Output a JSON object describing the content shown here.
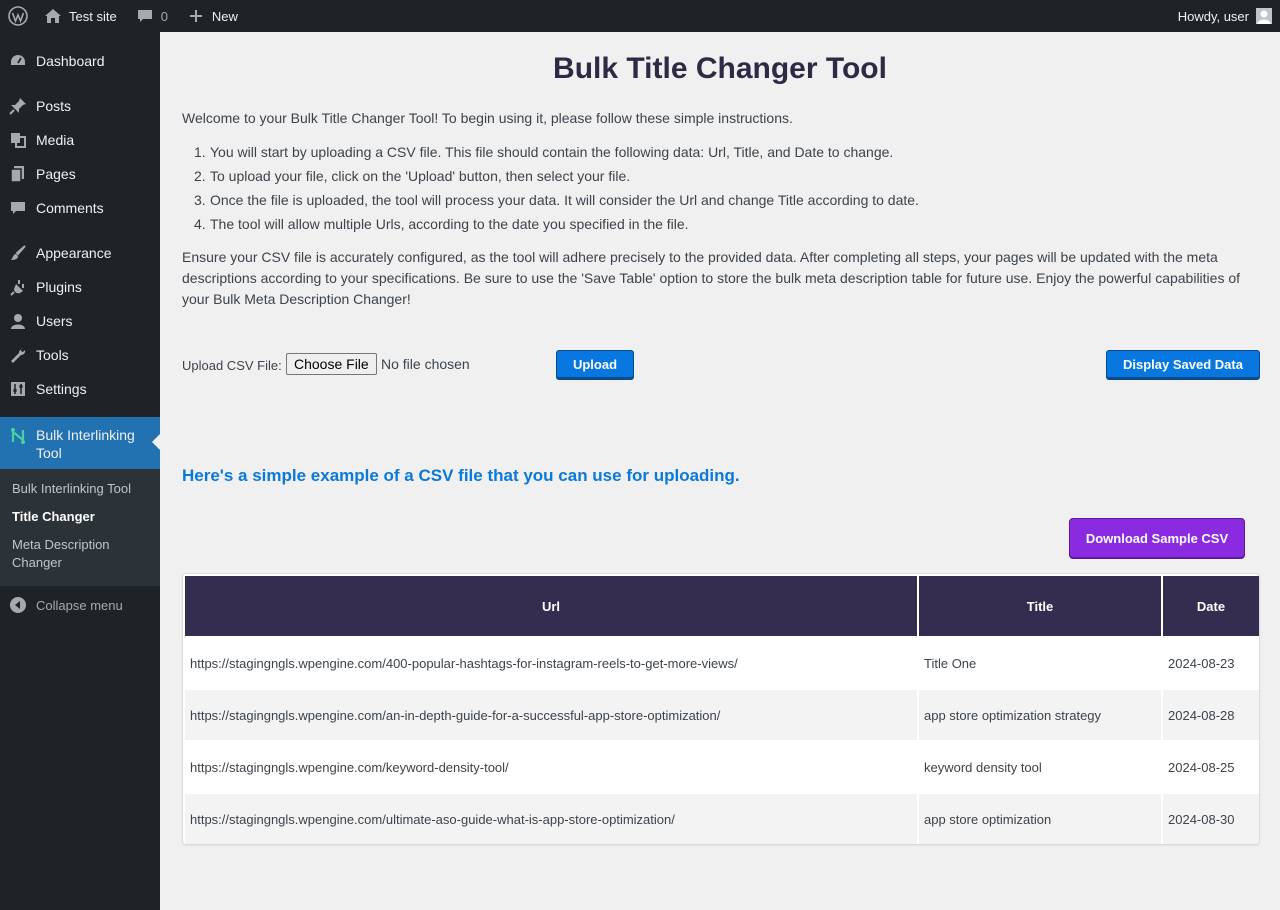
{
  "adminbar": {
    "site_name": "Test site",
    "comments_count": "0",
    "new_label": "New",
    "greeting": "Howdy, user"
  },
  "sidebar": {
    "items": [
      {
        "label": "Dashboard",
        "icon": "dashboard-icon"
      },
      {
        "label": "Posts",
        "icon": "pin-icon"
      },
      {
        "label": "Media",
        "icon": "media-icon"
      },
      {
        "label": "Pages",
        "icon": "pages-icon"
      },
      {
        "label": "Comments",
        "icon": "comment-icon"
      },
      {
        "label": "Appearance",
        "icon": "brush-icon"
      },
      {
        "label": "Plugins",
        "icon": "plugin-icon"
      },
      {
        "label": "Users",
        "icon": "user-icon"
      },
      {
        "label": "Tools",
        "icon": "wrench-icon"
      },
      {
        "label": "Settings",
        "icon": "settings-icon"
      }
    ],
    "current": {
      "label": "Bulk Interlinking Tool",
      "icon": "network-icon"
    },
    "submenu": [
      "Bulk Interlinking Tool",
      "Title Changer",
      "Meta Description Changer"
    ],
    "collapse_label": "Collapse menu"
  },
  "main": {
    "title": "Bulk Title Changer Tool",
    "intro": "Welcome to your Bulk Title Changer Tool! To begin using it, please follow these simple instructions.",
    "steps": [
      "You will start by uploading a CSV file. This file should contain the following data: Url, Title, and Date to change.",
      "To upload your file, click on the 'Upload' button, then select your file.",
      "Once the file is uploaded, the tool will process your data. It will consider the Url and change Title according to date.",
      "The tool will allow multiple Urls, according to the date you specified in the file."
    ],
    "note": "Ensure your CSV file is accurately configured, as the tool will adhere precisely to the provided data. After completing all steps, your pages will be updated with the meta descriptions according to your specifications. Be sure to use the 'Save Table' option to store the bulk meta description table for future use. Enjoy the powerful capabilities of your Bulk Meta Description Changer!",
    "upload_label": "Upload CSV File:",
    "choose_file_label": "Choose File",
    "no_file_text": "No file chosen",
    "upload_button": "Upload",
    "display_button": "Display Saved Data",
    "example_heading": "Here's a simple example of a CSV file that you can use for uploading.",
    "download_button": "Download Sample CSV",
    "table": {
      "headers": [
        "Url",
        "Title",
        "Date"
      ],
      "rows": [
        [
          "https://stagingngls.wpengine.com/400-popular-hashtags-for-instagram-reels-to-get-more-views/",
          "Title One",
          "2024-08-23"
        ],
        [
          "https://stagingngls.wpengine.com/an-in-depth-guide-for-a-successful-app-store-optimization/",
          "app store optimization strategy",
          "2024-08-28"
        ],
        [
          "https://stagingngls.wpengine.com/keyword-density-tool/",
          "keyword density tool",
          "2024-08-25"
        ],
        [
          "https://stagingngls.wpengine.com/ultimate-aso-guide-what-is-app-store-optimization/",
          "app store optimization",
          "2024-08-30"
        ]
      ]
    }
  },
  "colors": {
    "admin_dark": "#1d2327",
    "accent_blue": "#2271b1",
    "button_blue": "#0877e0",
    "purple": "#8a2be2",
    "table_header": "#342d4f",
    "heading_blue": "#0a79d9"
  }
}
